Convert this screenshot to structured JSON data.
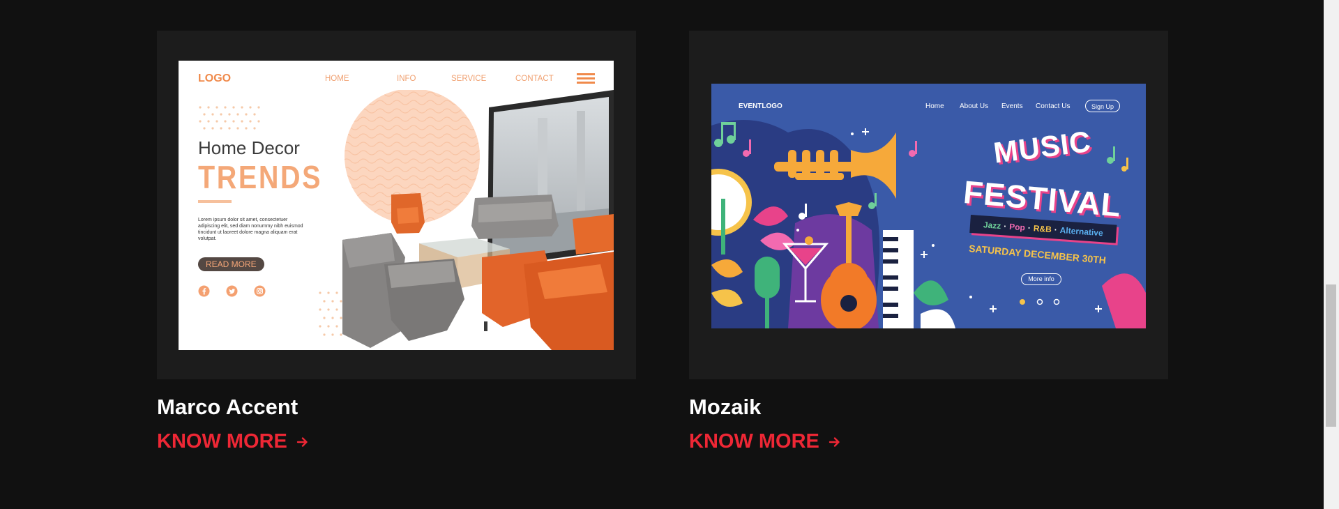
{
  "projects": [
    {
      "title": "Marco Accent",
      "cta": "KNOW MORE",
      "mockup": {
        "logo": "LOGO",
        "nav": [
          "HOME",
          "INFO",
          "SERVICE",
          "CONTACT"
        ],
        "heading_line1": "Home  Decor",
        "heading_line2": "TRENDS",
        "paragraph": "Lorem ipsum dolor sit amet, consectetuer adipiscing elit, sed diam nonummy nibh euismod tincidunt ut laoreet dolore magna aliquam erat volutpat.",
        "button": "READ MORE",
        "social_icons": [
          "facebook-icon",
          "twitter-icon",
          "instagram-icon"
        ]
      }
    },
    {
      "title": "Mozaik",
      "cta": "KNOW MORE",
      "mockup": {
        "logo": "EVENTLOGO",
        "nav": [
          "Home",
          "About Us",
          "Events",
          "Contact Us"
        ],
        "signup": "Sign Up",
        "title_line1": "MUSIC",
        "title_line2": "FESTIVAL",
        "genres": [
          "Jazz",
          "·",
          "Pop",
          "·",
          "R&B",
          "·",
          "Alternative"
        ],
        "date": "SATURDAY DECEMBER 30TH",
        "more": "More info"
      }
    }
  ],
  "colors": {
    "background": "#111111",
    "card": "#1c1c1c",
    "accent": "#ee2735",
    "title": "#ffffff",
    "mock_orange": "#f08a4b",
    "festival_blue": "#3a5aa8"
  }
}
